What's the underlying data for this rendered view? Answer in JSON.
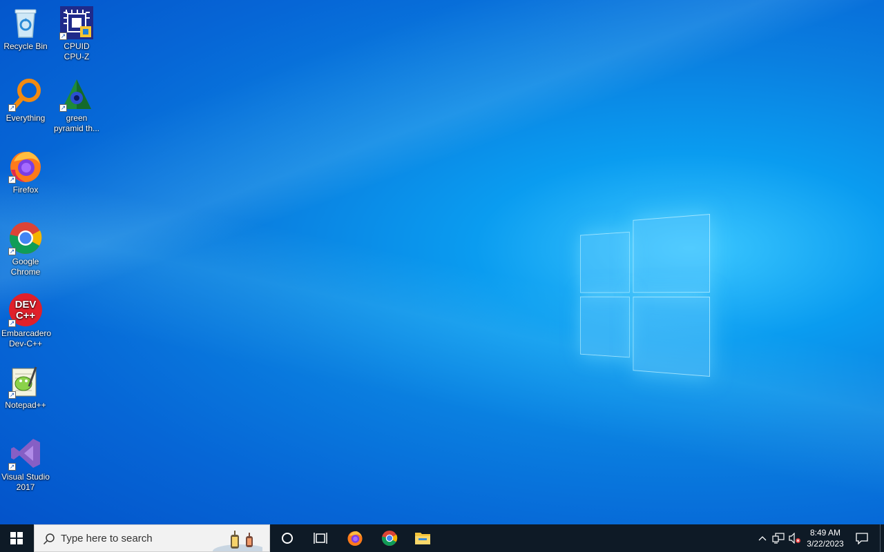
{
  "desktop": {
    "icons": [
      {
        "label": "Recycle Bin",
        "icon": "recycle-bin-icon"
      },
      {
        "label": "CPUID\nCPU-Z",
        "icon": "cpu-z-icon"
      },
      {
        "label": "Everything",
        "icon": "everything-search-icon"
      },
      {
        "label": "green\npyramid th...",
        "icon": "green-pyramid-icon"
      },
      {
        "label": "Firefox",
        "icon": "firefox-icon"
      },
      {
        "label": "Google\nChrome",
        "icon": "chrome-icon"
      },
      {
        "label": "Embarcadero\nDev-C++",
        "icon": "dev-cpp-icon"
      },
      {
        "label": "Notepad++",
        "icon": "notepad-plus-plus-icon"
      },
      {
        "label": "Visual Studio\n2017",
        "icon": "visual-studio-icon"
      }
    ],
    "devcpp_text": "DEV\nC++"
  },
  "taskbar": {
    "search_placeholder": "Type here to search",
    "pinned": [
      "firefox-icon",
      "chrome-icon",
      "file-explorer-icon"
    ],
    "clock_time": "8:49 AM",
    "clock_date": "3/22/2023"
  },
  "colors": {
    "taskbar_bg": "#0e1a26",
    "desktop_blue": "#0a7fe0",
    "start_icon": "#ffffff"
  }
}
